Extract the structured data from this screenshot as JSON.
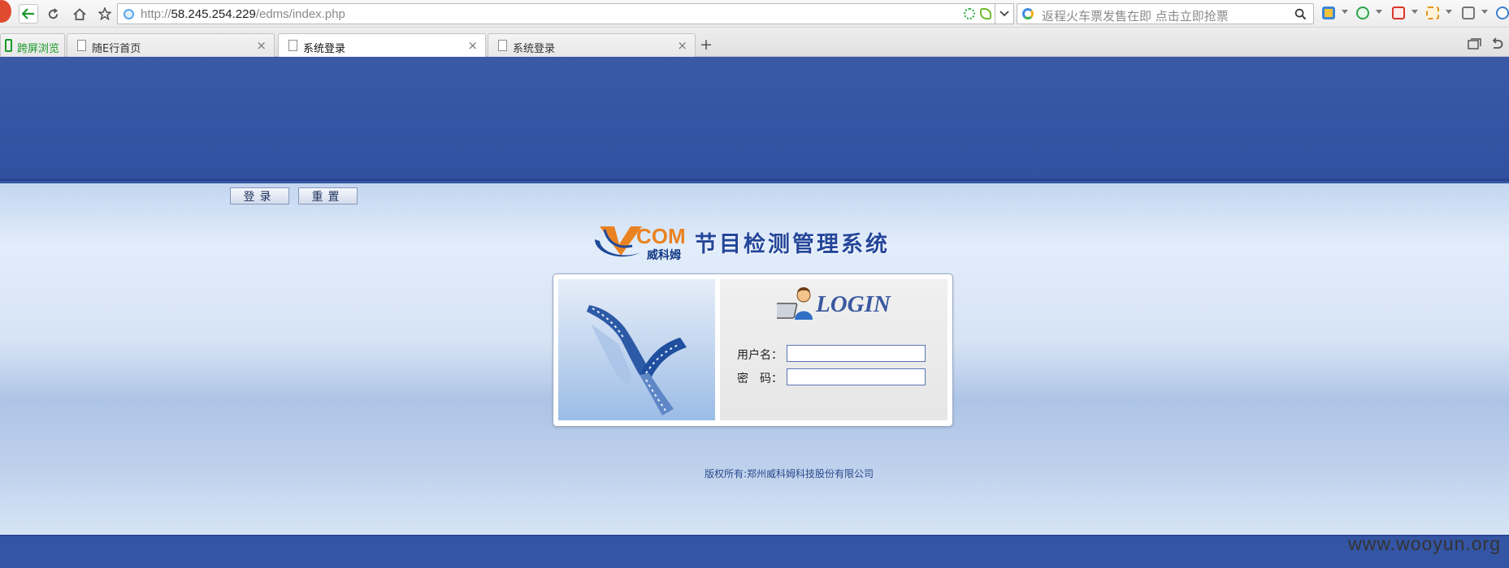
{
  "browser": {
    "url_prefix": "http://",
    "url_host": "58.245.254.229",
    "url_path": "/edms/index.php",
    "search_placeholder": "返程火车票发售在即 点击立即抢票",
    "tabs": [
      {
        "title": "跨屏浏览",
        "pinned": true
      },
      {
        "title": "随E行首页",
        "active": false
      },
      {
        "title": "系统登录",
        "active": true
      },
      {
        "title": "系统登录",
        "active": false
      }
    ],
    "new_tab_label": "+",
    "close_glyph": "×"
  },
  "page": {
    "logo_text": "COM",
    "logo_cn": "威科姆",
    "system_title": "节目检测管理系统",
    "login_heading": "LOGIN",
    "username_label": "用户名：",
    "password_label": "密　码：",
    "username_value": "",
    "password_value": "",
    "login_button": "登录",
    "reset_button": "重置",
    "copyright": "版权所有:郑州威科姆科技股份有限公司"
  },
  "watermark": "www.wooyun.org",
  "colors": {
    "page_blue": "#3657a6",
    "brand_orange": "#e98321",
    "title_blue": "#24469a",
    "login_blue": "#3b58a0"
  }
}
